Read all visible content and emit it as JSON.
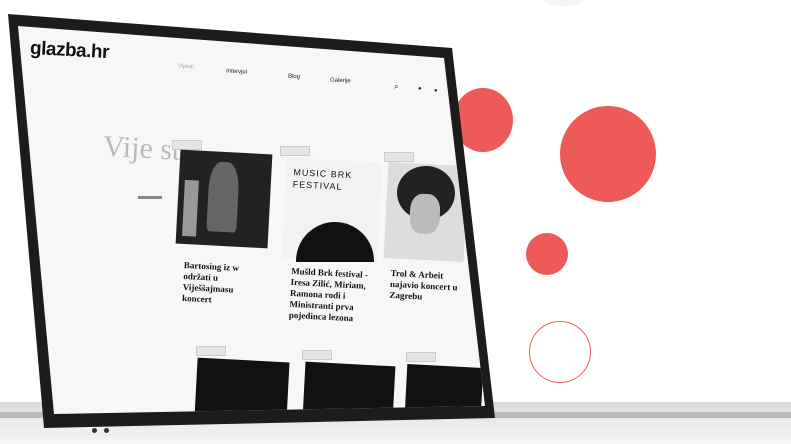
{
  "site": {
    "logo": "glazba.hr",
    "nav": [
      {
        "label": "Vijesti",
        "active": true
      },
      {
        "label": "Intervjui",
        "active": false
      },
      {
        "label": "Blog",
        "active": false
      },
      {
        "label": "Galerije",
        "active": false
      }
    ],
    "headline_logo": "Vije sti",
    "articles": [
      {
        "title": "Bartosing iz w održati u Viješšajmasu koncert"
      },
      {
        "title": "Mušld Brk festival - Iresa Zilić, Miriam, Ramona rodi i Ministranti prva pojedinca lezona"
      },
      {
        "title": "Trol & Arbeit najavio koncert u Zagrebu"
      }
    ],
    "poster_text": "MUSIC BRK FESTIVAL"
  },
  "colors": {
    "accent": "#ee5a57",
    "bezel": "#1c1c1c",
    "screen": "#f7f7f7"
  }
}
